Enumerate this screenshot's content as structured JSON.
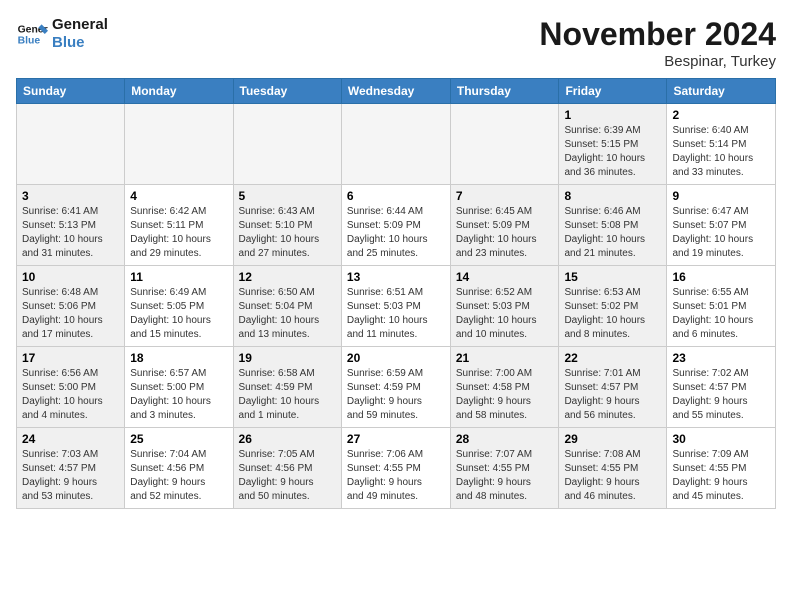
{
  "logo": {
    "line1": "General",
    "line2": "Blue"
  },
  "title": "November 2024",
  "location": "Bespinar, Turkey",
  "days_of_week": [
    "Sunday",
    "Monday",
    "Tuesday",
    "Wednesday",
    "Thursday",
    "Friday",
    "Saturday"
  ],
  "weeks": [
    [
      {
        "day": "",
        "info": "",
        "empty": true
      },
      {
        "day": "",
        "info": "",
        "empty": true
      },
      {
        "day": "",
        "info": "",
        "empty": true
      },
      {
        "day": "",
        "info": "",
        "empty": true
      },
      {
        "day": "",
        "info": "",
        "empty": true
      },
      {
        "day": "1",
        "info": "Sunrise: 6:39 AM\nSunset: 5:15 PM\nDaylight: 10 hours\nand 36 minutes.",
        "shaded": true
      },
      {
        "day": "2",
        "info": "Sunrise: 6:40 AM\nSunset: 5:14 PM\nDaylight: 10 hours\nand 33 minutes.",
        "shaded": false
      }
    ],
    [
      {
        "day": "3",
        "info": "Sunrise: 6:41 AM\nSunset: 5:13 PM\nDaylight: 10 hours\nand 31 minutes.",
        "shaded": true
      },
      {
        "day": "4",
        "info": "Sunrise: 6:42 AM\nSunset: 5:11 PM\nDaylight: 10 hours\nand 29 minutes.",
        "shaded": false
      },
      {
        "day": "5",
        "info": "Sunrise: 6:43 AM\nSunset: 5:10 PM\nDaylight: 10 hours\nand 27 minutes.",
        "shaded": true
      },
      {
        "day": "6",
        "info": "Sunrise: 6:44 AM\nSunset: 5:09 PM\nDaylight: 10 hours\nand 25 minutes.",
        "shaded": false
      },
      {
        "day": "7",
        "info": "Sunrise: 6:45 AM\nSunset: 5:09 PM\nDaylight: 10 hours\nand 23 minutes.",
        "shaded": true
      },
      {
        "day": "8",
        "info": "Sunrise: 6:46 AM\nSunset: 5:08 PM\nDaylight: 10 hours\nand 21 minutes.",
        "shaded": true
      },
      {
        "day": "9",
        "info": "Sunrise: 6:47 AM\nSunset: 5:07 PM\nDaylight: 10 hours\nand 19 minutes.",
        "shaded": false
      }
    ],
    [
      {
        "day": "10",
        "info": "Sunrise: 6:48 AM\nSunset: 5:06 PM\nDaylight: 10 hours\nand 17 minutes.",
        "shaded": true
      },
      {
        "day": "11",
        "info": "Sunrise: 6:49 AM\nSunset: 5:05 PM\nDaylight: 10 hours\nand 15 minutes.",
        "shaded": false
      },
      {
        "day": "12",
        "info": "Sunrise: 6:50 AM\nSunset: 5:04 PM\nDaylight: 10 hours\nand 13 minutes.",
        "shaded": true
      },
      {
        "day": "13",
        "info": "Sunrise: 6:51 AM\nSunset: 5:03 PM\nDaylight: 10 hours\nand 11 minutes.",
        "shaded": false
      },
      {
        "day": "14",
        "info": "Sunrise: 6:52 AM\nSunset: 5:03 PM\nDaylight: 10 hours\nand 10 minutes.",
        "shaded": true
      },
      {
        "day": "15",
        "info": "Sunrise: 6:53 AM\nSunset: 5:02 PM\nDaylight: 10 hours\nand 8 minutes.",
        "shaded": true
      },
      {
        "day": "16",
        "info": "Sunrise: 6:55 AM\nSunset: 5:01 PM\nDaylight: 10 hours\nand 6 minutes.",
        "shaded": false
      }
    ],
    [
      {
        "day": "17",
        "info": "Sunrise: 6:56 AM\nSunset: 5:00 PM\nDaylight: 10 hours\nand 4 minutes.",
        "shaded": true
      },
      {
        "day": "18",
        "info": "Sunrise: 6:57 AM\nSunset: 5:00 PM\nDaylight: 10 hours\nand 3 minutes.",
        "shaded": false
      },
      {
        "day": "19",
        "info": "Sunrise: 6:58 AM\nSunset: 4:59 PM\nDaylight: 10 hours\nand 1 minute.",
        "shaded": true
      },
      {
        "day": "20",
        "info": "Sunrise: 6:59 AM\nSunset: 4:59 PM\nDaylight: 9 hours\nand 59 minutes.",
        "shaded": false
      },
      {
        "day": "21",
        "info": "Sunrise: 7:00 AM\nSunset: 4:58 PM\nDaylight: 9 hours\nand 58 minutes.",
        "shaded": true
      },
      {
        "day": "22",
        "info": "Sunrise: 7:01 AM\nSunset: 4:57 PM\nDaylight: 9 hours\nand 56 minutes.",
        "shaded": true
      },
      {
        "day": "23",
        "info": "Sunrise: 7:02 AM\nSunset: 4:57 PM\nDaylight: 9 hours\nand 55 minutes.",
        "shaded": false
      }
    ],
    [
      {
        "day": "24",
        "info": "Sunrise: 7:03 AM\nSunset: 4:57 PM\nDaylight: 9 hours\nand 53 minutes.",
        "shaded": true
      },
      {
        "day": "25",
        "info": "Sunrise: 7:04 AM\nSunset: 4:56 PM\nDaylight: 9 hours\nand 52 minutes.",
        "shaded": false
      },
      {
        "day": "26",
        "info": "Sunrise: 7:05 AM\nSunset: 4:56 PM\nDaylight: 9 hours\nand 50 minutes.",
        "shaded": true
      },
      {
        "day": "27",
        "info": "Sunrise: 7:06 AM\nSunset: 4:55 PM\nDaylight: 9 hours\nand 49 minutes.",
        "shaded": false
      },
      {
        "day": "28",
        "info": "Sunrise: 7:07 AM\nSunset: 4:55 PM\nDaylight: 9 hours\nand 48 minutes.",
        "shaded": true
      },
      {
        "day": "29",
        "info": "Sunrise: 7:08 AM\nSunset: 4:55 PM\nDaylight: 9 hours\nand 46 minutes.",
        "shaded": true
      },
      {
        "day": "30",
        "info": "Sunrise: 7:09 AM\nSunset: 4:55 PM\nDaylight: 9 hours\nand 45 minutes.",
        "shaded": false
      }
    ]
  ]
}
